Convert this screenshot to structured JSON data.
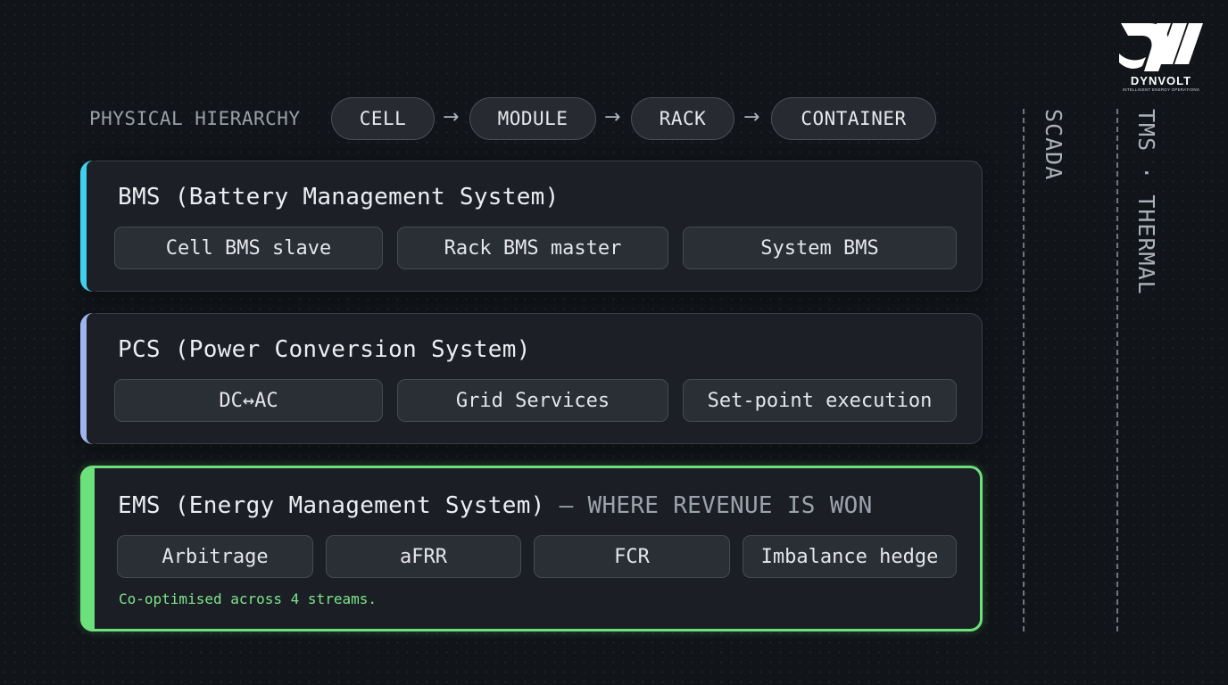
{
  "brand": {
    "name": "DYNVOLT",
    "tagline": "INTELLIGENT ENERGY OPERATIONS"
  },
  "hierarchy": {
    "label": "PHYSICAL HIERARCHY",
    "steps": [
      "CELL",
      "MODULE",
      "RACK",
      "CONTAINER"
    ],
    "arrow": "→"
  },
  "layers": {
    "bms": {
      "title": "BMS (Battery Management System)",
      "accent": "#3fd0ec",
      "items": [
        "Cell BMS slave",
        "Rack BMS master",
        "System BMS"
      ]
    },
    "pcs": {
      "title": "PCS (Power Conversion System)",
      "accent": "#9fb3ee",
      "items": [
        "DC↔AC",
        "Grid Services",
        "Set-point execution"
      ]
    },
    "ems": {
      "title": "EMS (Energy Management System)",
      "highlight": "— WHERE REVENUE IS WON",
      "accent": "#6ce07a",
      "items": [
        "Arbitrage",
        "aFRR",
        "FCR",
        "Imbalance hedge"
      ],
      "note": "Co-optimised across 4 streams."
    }
  },
  "side_labels": {
    "scada": "SCADA",
    "tms": "TMS · THERMAL"
  }
}
